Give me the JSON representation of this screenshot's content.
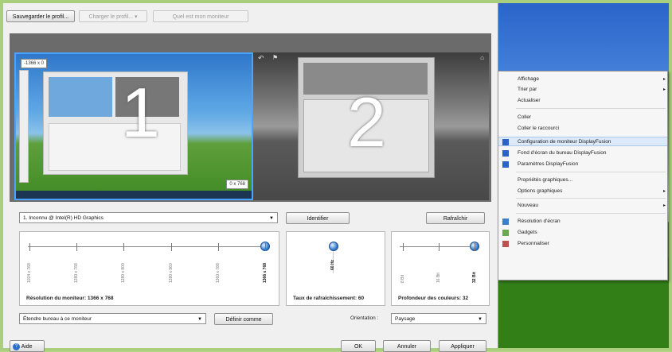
{
  "toolbar": {
    "save_profile": "Sauvegarder le profil...",
    "load_profile": "Charger le profil...",
    "identify_monitor": "Quel est mon moniteur"
  },
  "monitors": {
    "one": {
      "number": "1",
      "top_left": "-1366 x 0",
      "bottom_right": "0 x 768"
    },
    "two": {
      "number": "2"
    }
  },
  "controls": {
    "adapter_select": "1. Inconnu @ Intel(R) HD Graphics",
    "identify_button": "Identifier",
    "refresh_button": "Rafraîchir",
    "extend_select": "Étendre bureau à ce moniteur",
    "set_primary_button": "Définir comme",
    "orientation_label": "Orientation :",
    "orientation_value": "Paysage"
  },
  "resolution": {
    "label": "Résolution du moniteur: 1366 x 768",
    "ticks": [
      "1024 x 768",
      "1280 x 768",
      "1280 x 800",
      "1280 x 960",
      "1360 x 768",
      "1366 x 768"
    ],
    "selected": "1366 x 768",
    "selected_fraction": 1.0
  },
  "refresh": {
    "label": "Taux de rafraîchissement: 60",
    "selected": "60 Hz",
    "selected_fraction": 1.0
  },
  "color_depth": {
    "label": "Profondeur des couleurs: 32",
    "ticks": [
      "8 Bit",
      "16 Bit",
      "32 Bit"
    ],
    "selected": "32 Bit",
    "selected_fraction": 1.0
  },
  "footer": {
    "help": "Aide",
    "ok": "OK",
    "cancel": "Annuler",
    "apply": "Appliquer"
  },
  "context_menu": {
    "items": [
      {
        "label": "Affichage",
        "submenu": true,
        "icon": "none"
      },
      {
        "label": "Trier par",
        "submenu": true,
        "icon": "none"
      },
      {
        "label": "Actualiser",
        "submenu": false,
        "icon": "none"
      },
      {
        "label": "Coller",
        "submenu": false,
        "icon": "none"
      },
      {
        "label": "Coller le raccourci",
        "submenu": false,
        "icon": "none"
      },
      {
        "label": "Configuration de moniteur DisplayFusion",
        "submenu": false,
        "icon": "displayfusion-icon",
        "highlighted": true
      },
      {
        "label": "Fond d'écran du bureau DisplayFusion",
        "submenu": false,
        "icon": "displayfusion-icon"
      },
      {
        "label": "Paramètres DisplayFusion",
        "submenu": false,
        "icon": "displayfusion-icon"
      },
      {
        "label": "Propriétés graphiques...",
        "submenu": false,
        "icon": "none"
      },
      {
        "label": "Options graphiques",
        "submenu": true,
        "icon": "none"
      },
      {
        "label": "Nouveau",
        "submenu": true,
        "icon": "none"
      },
      {
        "label": "Résolution d'écran",
        "submenu": false,
        "icon": "monitor-icon"
      },
      {
        "label": "Gadgets",
        "submenu": false,
        "icon": "gadgets-icon"
      },
      {
        "label": "Personnaliser",
        "submenu": false,
        "icon": "personalize-icon"
      }
    ]
  },
  "colors": {
    "accent": "#4aa3ff",
    "menu_highlight": "#dbe9f9"
  }
}
